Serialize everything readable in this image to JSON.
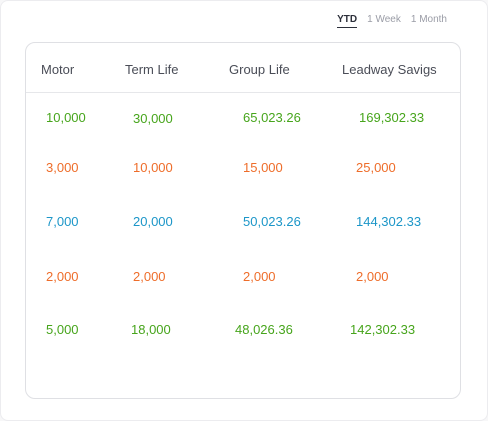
{
  "period_tabs": [
    {
      "label": "YTD",
      "active": true
    },
    {
      "label": "1 Week",
      "active": false
    },
    {
      "label": "1 Month",
      "active": false
    }
  ],
  "table": {
    "headers": [
      "Motor",
      "Term Life",
      "Group Life",
      "Leadway Savigs"
    ],
    "rows": [
      {
        "color": "#47a51c",
        "values": [
          "10,000",
          "30,000",
          "65,023.26",
          "169,302.33"
        ]
      },
      {
        "color": "#ee6d2a",
        "values": [
          "3,000",
          "10,000",
          "15,000",
          "25,000"
        ]
      },
      {
        "color": "#1c96c8",
        "values": [
          "7,000",
          "20,000",
          "50,023.26",
          "144,302.33"
        ]
      },
      {
        "color": "#ee6d2a",
        "values": [
          "2,000",
          "2,000",
          "2,000",
          "2,000"
        ]
      },
      {
        "color": "#47a51c",
        "values": [
          "5,000",
          "18,000",
          "48,026.36",
          "142,302.33"
        ]
      }
    ]
  }
}
